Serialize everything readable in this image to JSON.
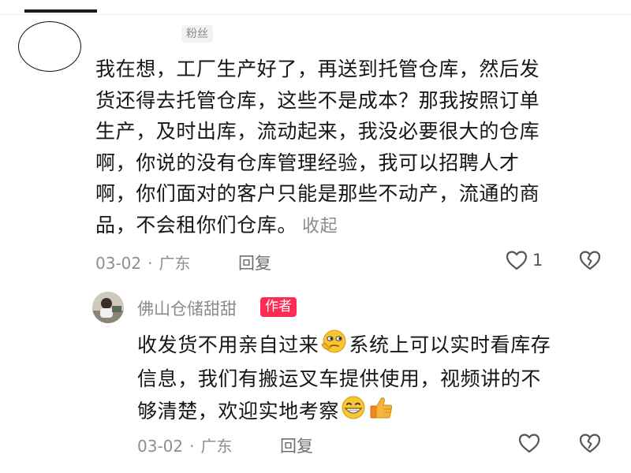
{
  "comment": {
    "badge": "粉丝",
    "lines": [
      "我在想，工厂生产好了，再送到托管仓库，然后发",
      "货还得去托管仓库，这些不是成本？那我按照订单",
      "生产，及时出库，流动起来，我没必要很大的仓库",
      "啊，你说的没有仓库管理经验，我可以招聘人才",
      "啊，你们面对的客户只能是那些不动产，流通的商",
      "品，不会租你们仓库。"
    ],
    "collapse_label": "收起",
    "date": "03-02",
    "separator": "·",
    "location": "广东",
    "reply_label": "回复",
    "like_count": "1"
  },
  "reply": {
    "author": "佛山仓储甜甜",
    "author_badge": "作者",
    "line1_a": "收发货不用亲自过来",
    "line1_emoji": "thinking-face-emoji",
    "line1_b": "系统上可以实时看库存",
    "line2": "信息，我们有搬运叉车提供使用，视频讲的不",
    "line3": "够清楚，欢迎实地考察",
    "line3_emojis": [
      "grinning-face-emoji",
      "thumbs-up-emoji"
    ],
    "date": "03-02",
    "separator": "·",
    "location": "广东",
    "reply_label": "回复"
  },
  "colors": {
    "author_badge_bg": "#fe2c55",
    "text": "#161616",
    "meta": "#8e8e8e"
  }
}
